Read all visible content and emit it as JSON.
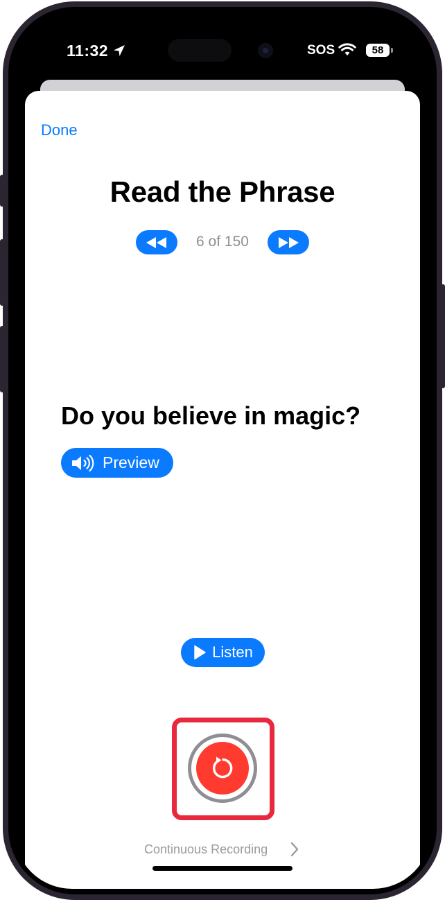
{
  "status_bar": {
    "time": "11:32",
    "sos": "SOS",
    "battery": "58"
  },
  "sheet": {
    "done_label": "Done",
    "title": "Read the Phrase",
    "counter": "6 of 150",
    "phrase": "Do you believe in magic?",
    "preview_label": "Preview",
    "listen_label": "Listen",
    "continuous_label": "Continuous Recording"
  },
  "colors": {
    "accent": "#0a7aff",
    "record": "#ff3b30",
    "highlight": "#e8283c",
    "secondary_text": "#8e8e93"
  },
  "icons": [
    "location-arrow-icon",
    "wifi-icon",
    "battery-icon",
    "rewind-icon",
    "fast-forward-icon",
    "speaker-icon",
    "play-icon",
    "redo-icon",
    "chevron-right-icon"
  ]
}
